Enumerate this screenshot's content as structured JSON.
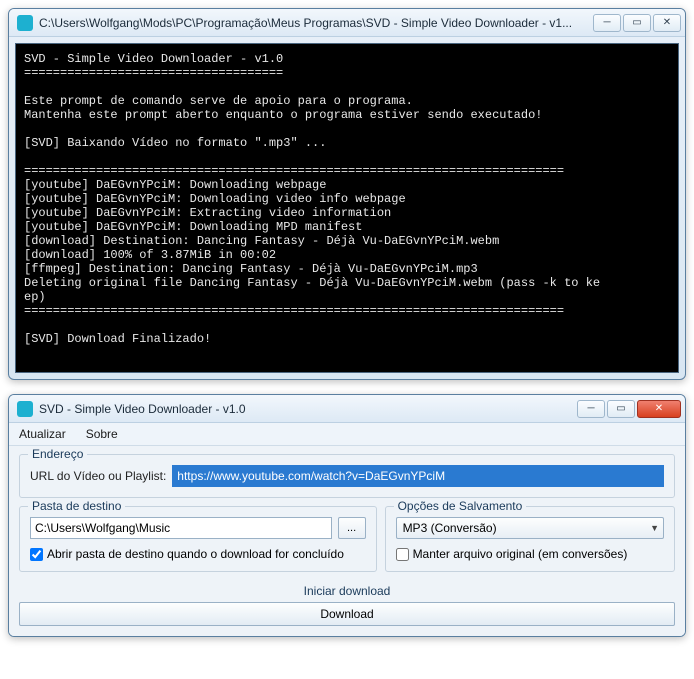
{
  "console": {
    "title": "C:\\Users\\Wolfgang\\Mods\\PC\\Programação\\Meus Programas\\SVD - Simple Video Downloader - v1...",
    "text": "SVD - Simple Video Downloader - v1.0\n====================================\n\nEste prompt de comando serve de apoio para o programa.\nMantenha este prompt aberto enquanto o programa estiver sendo executado!\n\n[SVD] Baixando Vídeo no formato \".mp3\" ...\n\n===========================================================================\n[youtube] DaEGvnYPciM: Downloading webpage\n[youtube] DaEGvnYPciM: Downloading video info webpage\n[youtube] DaEGvnYPciM: Extracting video information\n[youtube] DaEGvnYPciM: Downloading MPD manifest\n[download] Destination: Dancing Fantasy - Déjà Vu-DaEGvnYPciM.webm\n[download] 100% of 3.87MiB in 00:02\n[ffmpeg] Destination: Dancing Fantasy - Déjà Vu-DaEGvnYPciM.mp3\nDeleting original file Dancing Fantasy - Déjà Vu-DaEGvnYPciM.webm (pass -k to ke\nep)\n===========================================================================\n\n[SVD] Download Finalizado!"
  },
  "app": {
    "title": "SVD - Simple Video Downloader - v1.0",
    "menu": {
      "atualizar": "Atualizar",
      "sobre": "Sobre"
    },
    "endereco": {
      "legend": "Endereço",
      "label": "URL do Vídeo ou Playlist:",
      "value": "https://www.youtube.com/watch?v=DaEGvnYPciM"
    },
    "pasta": {
      "legend": "Pasta de destino",
      "value": "C:\\Users\\Wolfgang\\Music",
      "browse": "...",
      "check_label": "Abrir pasta de destino quando o download for concluído",
      "check_value": true
    },
    "opcoes": {
      "legend": "Opções de Salvamento",
      "select_value": "MP3 (Conversão)",
      "check_label": "Manter arquivo original (em conversões)",
      "check_value": false
    },
    "start": {
      "legend": "Iniciar download",
      "button": "Download"
    }
  }
}
